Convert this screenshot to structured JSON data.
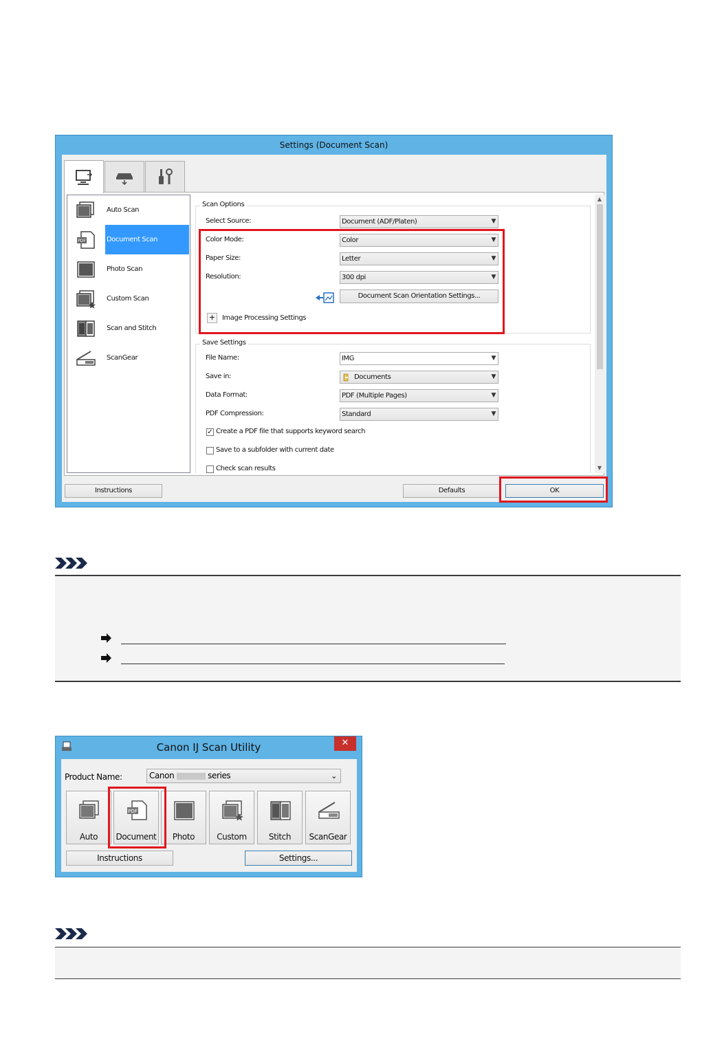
{
  "settings_dialog": {
    "title": "Settings (Document Scan)",
    "tab_icons": [
      "scan-from-computer-icon",
      "scan-from-panel-icon",
      "general-settings-icon"
    ],
    "nav_items": [
      {
        "label": "Auto Scan",
        "icon": "auto-scan-icon"
      },
      {
        "label": "Document Scan",
        "icon": "document-scan-icon"
      },
      {
        "label": "Photo Scan",
        "icon": "photo-scan-icon"
      },
      {
        "label": "Custom Scan",
        "icon": "custom-scan-icon"
      },
      {
        "label": "Scan and Stitch",
        "icon": "scan-and-stitch-icon"
      },
      {
        "label": "ScanGear",
        "icon": "scangear-icon"
      }
    ],
    "selected_nav": "Document Scan",
    "scan_options": {
      "title": "Scan Options",
      "select_source_label": "Select Source:",
      "select_source_value": "Document (ADF/Platen)",
      "color_mode_label": "Color Mode:",
      "color_mode_value": "Color",
      "paper_size_label": "Paper Size:",
      "paper_size_value": "Letter",
      "resolution_label": "Resolution:",
      "resolution_value": "300 dpi",
      "orientation_button": "Document Scan Orientation Settings...",
      "image_processing_label": "Image Processing Settings",
      "expand_symbol": "+"
    },
    "save_settings": {
      "title": "Save Settings",
      "file_name_label": "File Name:",
      "file_name_value": "IMG",
      "save_in_label": "Save in:",
      "save_in_value": "Documents",
      "data_format_label": "Data Format:",
      "data_format_value": "PDF (Multiple Pages)",
      "pdf_compression_label": "PDF Compression:",
      "pdf_compression_value": "Standard",
      "checkboxes": [
        {
          "label": "Create a PDF file that supports keyword search",
          "checked": true
        },
        {
          "label": "Save to a subfolder with current date",
          "checked": false
        },
        {
          "label": "Check scan results",
          "checked": false
        }
      ]
    },
    "buttons": {
      "instructions": "Instructions",
      "defaults": "Defaults",
      "ok": "OK"
    },
    "highlight_color": "#e0161c",
    "selection_color": "#3399ff"
  },
  "scan_utility": {
    "title": "Canon IJ Scan Utility",
    "close_symbol": "✕",
    "product_name_label": "Product Name:",
    "product_name_prefix": "Canon",
    "product_name_suffix": "series",
    "scan_buttons": [
      {
        "label": "Auto",
        "icon": "auto-scan-icon"
      },
      {
        "label": "Document",
        "icon": "document-scan-icon"
      },
      {
        "label": "Photo",
        "icon": "photo-scan-icon"
      },
      {
        "label": "Custom",
        "icon": "custom-scan-icon"
      },
      {
        "label": "Stitch",
        "icon": "stitch-icon"
      },
      {
        "label": "ScanGear",
        "icon": "scangear-icon"
      }
    ],
    "instructions_button": "Instructions",
    "settings_button": "Settings..."
  }
}
